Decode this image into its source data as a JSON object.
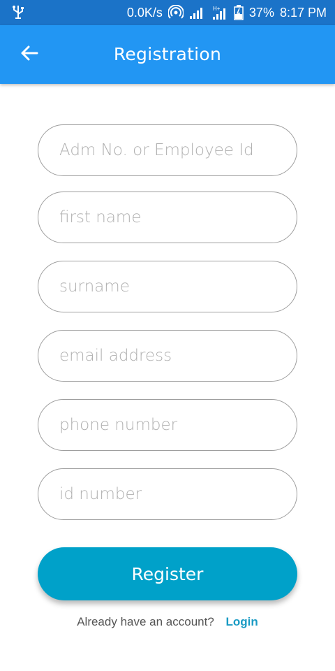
{
  "status_bar": {
    "net_speed": "0.0K/s",
    "battery": "37%",
    "time": "8:17 PM",
    "background": "#1b73c8"
  },
  "app_bar": {
    "title": "Registration",
    "background": "#2296f3"
  },
  "form": {
    "adm_placeholder": "Adm No. or Employee Id",
    "first_name_placeholder": "first name",
    "surname_placeholder": "surname",
    "email_placeholder": "email address",
    "phone_placeholder": "phone number",
    "id_number_placeholder": "id number",
    "register_label": "Register",
    "register_color": "#00a1c9"
  },
  "footer": {
    "prompt": "Already have an account?",
    "login_label": "Login",
    "link_color": "#1a9bc4"
  }
}
